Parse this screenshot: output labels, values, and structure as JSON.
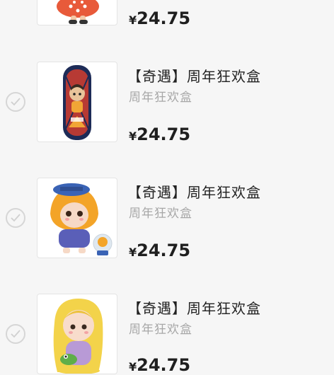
{
  "items": [
    {
      "title": "",
      "subtitle": "",
      "currency": "¥",
      "price": "24.75",
      "image_icon": "cartoon-figure-skirt"
    },
    {
      "title": "【奇遇】周年狂欢盒",
      "subtitle": "周年狂欢盒",
      "currency": "¥",
      "price": "24.75",
      "image_icon": "fingerboard-skateboard"
    },
    {
      "title": "【奇遇】周年狂欢盒",
      "subtitle": "周年狂欢盒",
      "currency": "¥",
      "price": "24.75",
      "image_icon": "orange-hat-figure"
    },
    {
      "title": "【奇遇】周年狂欢盒",
      "subtitle": "周年狂欢盒",
      "currency": "¥",
      "price": "24.75",
      "image_icon": "rapunzel-figure"
    }
  ]
}
